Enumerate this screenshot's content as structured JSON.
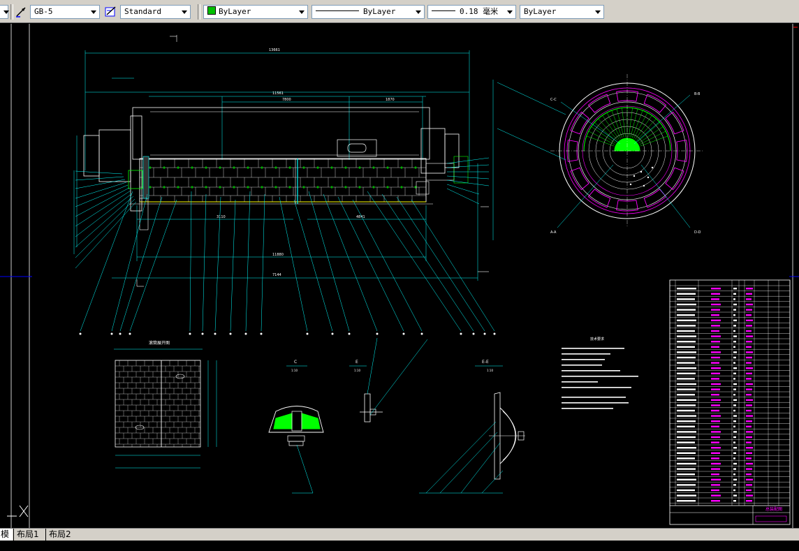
{
  "toolbar": {
    "dimstyle": "GB-5",
    "textstyle": "Standard",
    "color": "ByLayer",
    "linetype": "ByLayer",
    "lineweight": "0.18 毫米",
    "plotstyle": "ByLayer",
    "color_swatch": "#00c000"
  },
  "drawing": {
    "notes_title": "技术要求",
    "table_title": "总装配图",
    "section_c": "C",
    "section_e": "E",
    "section_ee": "E-E",
    "detail_title": "滚筒展开图",
    "scale_c": "1:10",
    "scale_e": "1:10",
    "scale_ee": "1:10",
    "dim_total": "13661",
    "dim_body": "11561",
    "dim_inner": "7800",
    "dim_right": "1870",
    "dim_bottom1": "3110",
    "dim_bottom2": "4841",
    "dim_overall": "11880",
    "dim_base": "7144",
    "label_a": "A-A",
    "label_b": "B-B",
    "label_d": "D-D",
    "label_cc": "C-C"
  },
  "tabs": {
    "model": "模型",
    "layout1": "布局1",
    "layout2": "布局2"
  },
  "colors": {
    "background": "#000000",
    "cyan": "#00ffff",
    "white": "#ffffff",
    "magenta": "#ff00ff",
    "green": "#00ff00",
    "yellow": "#ffff00"
  }
}
